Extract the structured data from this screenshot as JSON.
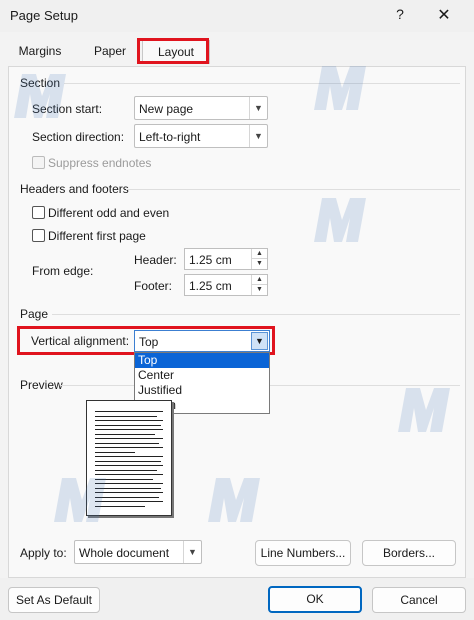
{
  "window": {
    "title": "Page Setup",
    "help_glyph": "?",
    "close_glyph": "✕"
  },
  "tabs": [
    {
      "label": "Margins"
    },
    {
      "label": "Paper"
    },
    {
      "label": "Layout",
      "active": true
    }
  ],
  "section": {
    "title": "Section",
    "start_label": "Section start:",
    "start_value": "New page",
    "direction_label": "Section direction:",
    "direction_value": "Left-to-right",
    "suppress_endnotes_label": "Suppress endnotes",
    "suppress_endnotes_checked": false
  },
  "headers_footers": {
    "title": "Headers and footers",
    "odd_even_label": "Different odd and even",
    "odd_even_checked": false,
    "first_page_label": "Different first page",
    "first_page_checked": false,
    "from_edge_label": "From edge:",
    "header_label": "Header:",
    "header_value": "1.25 cm",
    "footer_label": "Footer:",
    "footer_value": "1.25 cm"
  },
  "page": {
    "title": "Page",
    "vertical_alignment_label": "Vertical alignment:",
    "vertical_alignment_value": "Top",
    "options": [
      "Top",
      "Center",
      "Justified",
      "Bottom"
    ],
    "selected_option": "Top"
  },
  "preview": {
    "title": "Preview"
  },
  "apply": {
    "label": "Apply to:",
    "value": "Whole document"
  },
  "buttons": {
    "line_numbers": "Line Numbers...",
    "borders": "Borders...",
    "set_default": "Set As Default",
    "ok": "OK",
    "cancel": "Cancel"
  },
  "colors": {
    "highlight": "#e0141e",
    "selection": "#0a64d6",
    "primary_border": "#0067c0"
  },
  "icons": {
    "dropdown_arrow": "chevron-down-icon",
    "spin_up": "spin-up-icon",
    "spin_down": "spin-down-icon"
  }
}
